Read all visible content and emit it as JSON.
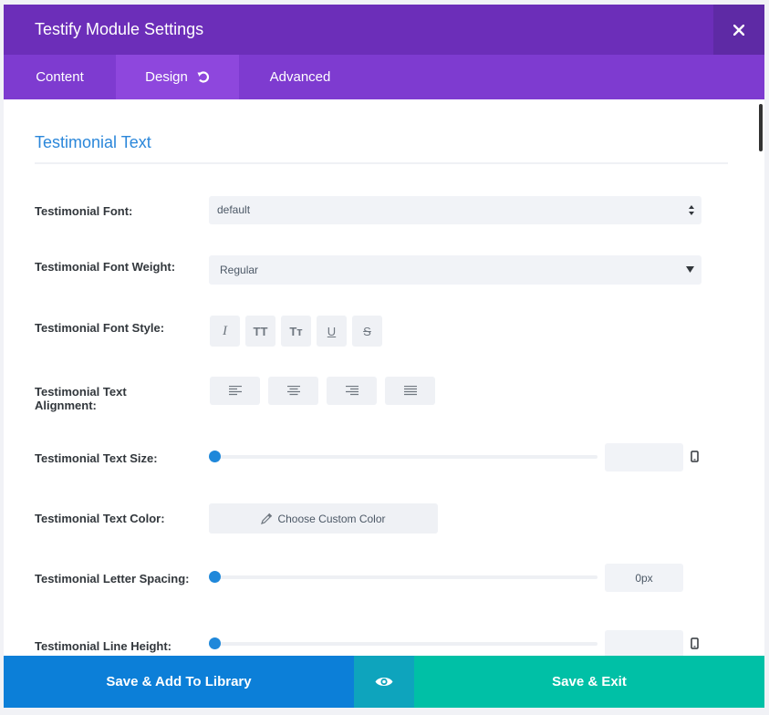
{
  "header": {
    "title": "Testify Module Settings"
  },
  "tabs": [
    {
      "label": "Content"
    },
    {
      "label": "Design"
    },
    {
      "label": "Advanced"
    }
  ],
  "section": {
    "title": "Testimonial Text"
  },
  "fields": {
    "font": {
      "label": "Testimonial Font:",
      "value": "default"
    },
    "font_weight": {
      "label": "Testimonial Font Weight:",
      "value": "Regular"
    },
    "font_style": {
      "label": "Testimonial Font Style:",
      "buttons": [
        "I",
        "TT",
        "Tт",
        "U",
        "S"
      ]
    },
    "text_alignment": {
      "label": "Testimonial Text Alignment:"
    },
    "text_size": {
      "label": "Testimonial Text Size:",
      "value": ""
    },
    "text_color": {
      "label": "Testimonial Text Color:",
      "button": "Choose Custom Color"
    },
    "letter_spacing": {
      "label": "Testimonial Letter Spacing:",
      "value": "0px"
    },
    "line_height": {
      "label": "Testimonial Line Height:",
      "value": ""
    }
  },
  "footer": {
    "save_library": "Save & Add To Library",
    "save_exit": "Save & Exit"
  },
  "colors": {
    "header": "#6c2eb9",
    "tabs": "#7e3bd0",
    "active_tab": "#8e47dd",
    "accent": "#2b87da",
    "save_library": "#0c7fd8",
    "preview": "#0ea4bd",
    "save_exit": "#00c0a6"
  }
}
